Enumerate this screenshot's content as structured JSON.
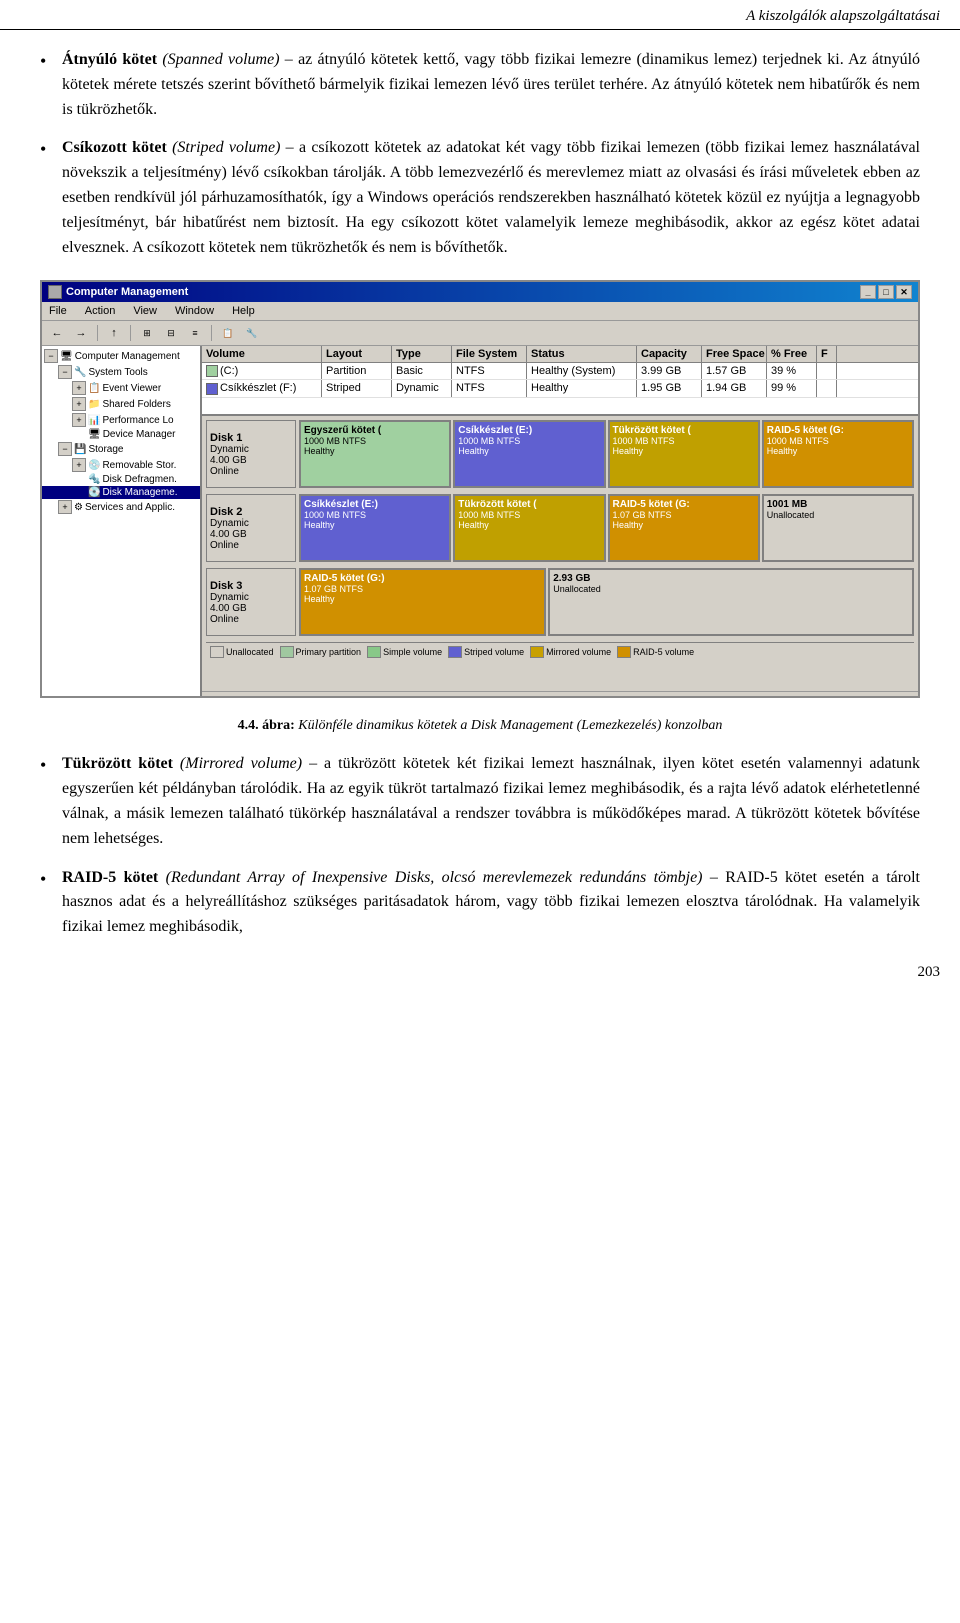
{
  "header": {
    "title": "A kiszolgálók alapszolgáltatásai"
  },
  "bullets": [
    {
      "id": "atnyulo",
      "bold": "Átnyúló kötet",
      "italic_paren": "(Spanned volume)",
      "text": " – az átnyúló kötetek kettő, vagy több fizikai lemezre (dinamikus lemez) terjednek ki. Az átnyúló kötetek mérete tetszés szerint bővíthető bármelyik fizikai lemezen lévő üres terület terhére. Az átnyúló kötetek nem hibatűrők és nem is tükrözhetők."
    },
    {
      "id": "csikozott",
      "bold": "Csíkozott kötet",
      "italic_paren": "(Striped volume)",
      "text": " – a csíkozott kötetek az adatokat két vagy több fizikai lemezen (több fizikai lemez használatával növekszik a teljesítmény) lévő csíkokban tárolják. A több lemezvezérlő és merevlemez miatt az olvasási és írási műveletek ebben az esetben rendkívül jól párhuzamosíthatók, így a Windows operációs rendszerekben használható kötetek közül ez nyújtja a legnagyobb teljesítményt, bár hibatűrést nem biztosít. Ha egy csíkozott kötet valamelyik lemeze meghibásodik, akkor az egész kötet adatai elvesznek. A csíkozott kötetek nem tükrözhetők és nem is bővíthetők."
    }
  ],
  "screenshot": {
    "title": "Computer Management",
    "menu_items": [
      "File",
      "Action",
      "View",
      "Window",
      "Help"
    ],
    "tree": {
      "items": [
        {
          "label": "Computer Management",
          "level": 0,
          "expanded": true,
          "selected": false
        },
        {
          "label": "System Tools",
          "level": 1,
          "expanded": true,
          "selected": false
        },
        {
          "label": "Event Viewer",
          "level": 2,
          "expanded": false,
          "selected": false
        },
        {
          "label": "Shared Folders",
          "level": 2,
          "expanded": false,
          "selected": false
        },
        {
          "label": "Performance Lo",
          "level": 2,
          "expanded": false,
          "selected": false
        },
        {
          "label": "Device Manager",
          "level": 2,
          "expanded": false,
          "selected": false
        },
        {
          "label": "Storage",
          "level": 1,
          "expanded": true,
          "selected": false
        },
        {
          "label": "Removable Stor.",
          "level": 2,
          "expanded": false,
          "selected": false
        },
        {
          "label": "Disk Defragmen.",
          "level": 2,
          "expanded": false,
          "selected": false
        },
        {
          "label": "Disk Manageme.",
          "level": 2,
          "expanded": false,
          "selected": true
        },
        {
          "label": "Services and Applic.",
          "level": 1,
          "expanded": false,
          "selected": false
        }
      ]
    },
    "volume_columns": [
      "Volume",
      "Layout",
      "Type",
      "File System",
      "Status",
      "Capacity",
      "Free Space",
      "% Free",
      "F"
    ],
    "volumes": [
      {
        "volume": "(C:)",
        "layout": "Partition",
        "type": "Basic",
        "fs": "NTFS",
        "status": "Healthy (System)",
        "capacity": "3.99 GB",
        "free": "1.57 GB",
        "pct": "39 %",
        "f": ""
      },
      {
        "volume": "Csíkkészlet (F:)",
        "layout": "Striped",
        "type": "Dynamic",
        "fs": "NTFS",
        "status": "Healthy",
        "capacity": "1.95 GB",
        "free": "1.94 GB",
        "pct": "99 %",
        "f": ""
      }
    ],
    "disks": [
      {
        "label": "Disk 1",
        "type": "Dynamic",
        "size": "4.00 GB",
        "status": "Online",
        "partitions": [
          {
            "label": "Egyszerű kötet (",
            "detail": "1000 MB NTFS\nHealthy",
            "color": "simple",
            "flex": 1
          },
          {
            "label": "Csíkkészlet (E:)",
            "detail": "1000 MB NTFS\nHealthy",
            "color": "striped",
            "flex": 1
          },
          {
            "label": "Tükrözött kötet (",
            "detail": "1000 MB NTFS\nHealthy",
            "color": "mirrored",
            "flex": 1
          },
          {
            "label": "RAID-5 kötet (G:",
            "detail": "1000 MB NTFS\nHealthy",
            "color": "raid5",
            "flex": 1
          }
        ]
      },
      {
        "label": "Disk 2",
        "type": "Dynamic",
        "size": "4.00 GB",
        "status": "Online",
        "partitions": [
          {
            "label": "Csíkkészlet (E:)",
            "detail": "1000 MB NTFS\nHealthy",
            "color": "striped",
            "flex": 1
          },
          {
            "label": "Tükrözött kötet (",
            "detail": "1000 MB NTFS\nHealthy",
            "color": "mirrored",
            "flex": 1
          },
          {
            "label": "RAID-5 kötet (G:",
            "detail": "1.07 GB NTFS\nHealthy",
            "color": "raid5",
            "flex": 1
          },
          {
            "label": "1001 MB\nUnallocated",
            "detail": "",
            "color": "unalloc",
            "flex": 1
          }
        ]
      },
      {
        "label": "Disk 3",
        "type": "Dynamic",
        "size": "4.00 GB",
        "status": "Online",
        "partitions": [
          {
            "label": "RAID-5 kötet (G:)",
            "detail": "1.07 GB NTFS\nHealthy",
            "color": "raid5",
            "flex": 2
          },
          {
            "label": "2.93 GB\nUnallocated",
            "detail": "",
            "color": "unalloc",
            "flex": 3
          }
        ]
      }
    ],
    "legend": [
      {
        "label": "Unallocated",
        "color": "#d4d0c8"
      },
      {
        "label": "Primary partition",
        "color": "#a0c8a0"
      },
      {
        "label": "Simple volume",
        "color": "#88c888"
      },
      {
        "label": "Striped volume",
        "color": "#6060d0"
      },
      {
        "label": "Mirrored volume",
        "color": "#c8a000"
      },
      {
        "label": "RAID-5 volume",
        "color": "#d09000"
      }
    ]
  },
  "caption": {
    "number": "4.4.",
    "text": "ábra:",
    "italic": "Különféle dinamikus kötetek a Disk Management (Lemezkezelés) konzolban"
  },
  "bullets2": [
    {
      "id": "tukrozott",
      "bold": "Tükrözött kötet",
      "italic_paren": "(Mirrored volume)",
      "text": " – a tükrözött kötetek két fizikai lemezt használnak, ilyen kötet esetén valamennyi adatunk egyszerűen két példányban tárolódik. Ha az egyik tükröt tartalmazó fizikai lemez meghibásodik, és a rajta lévő adatok elérhetetlenné válnak, a másik lemezen található tükörkép használatával a rendszer továbbra is működőképes marad. A tükrözött kötetek bővítése nem lehetséges."
    },
    {
      "id": "raid5",
      "bold": "RAID-5 kötet",
      "italic_paren": "(Redundant Array of Inexpensive Disks, olcsó merevlemezek redundáns tömbje)",
      "text": " – RAID-5 kötet esetén a tárolt hasznos adat és a helyreállításhoz szükséges paritásadatok három, vagy több fizikai lemezen elosztva tárolódnak. Ha valamelyik fizikai lemez meghibásodik,"
    }
  ],
  "page_number": "203"
}
